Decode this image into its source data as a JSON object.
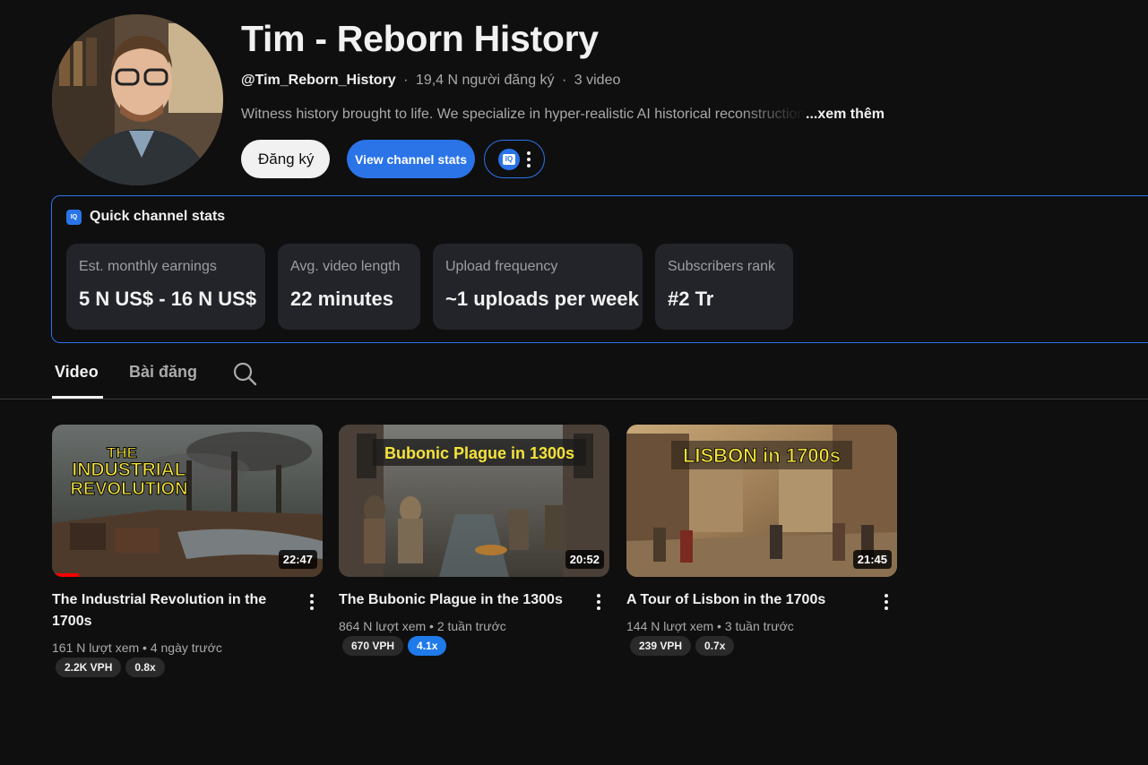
{
  "channel": {
    "name": "Tim - Reborn History",
    "handle": "@Tim_Reborn_History",
    "subscribers": "19,4 N người đăng ký",
    "videos_count": "3 video",
    "meta_separator": "·",
    "description": "Witness history brought to life. We specialize in hyper-realistic AI historical reconstructions",
    "more_label": "...xem thêm"
  },
  "actions": {
    "subscribe_label": "Đăng ký",
    "stats_label": "View channel stats"
  },
  "quick_stats": {
    "title": "Quick channel stats",
    "cards": [
      {
        "label": "Est. monthly earnings",
        "value": "5 N US$ - 16 N US$"
      },
      {
        "label": "Avg. video length",
        "value": "22 minutes"
      },
      {
        "label": "Upload frequency",
        "value": "~1 uploads per week"
      },
      {
        "label": "Subscribers rank",
        "value": "#2 Tr"
      }
    ]
  },
  "tabs": [
    {
      "label": "Video",
      "active": true
    },
    {
      "label": "Bài đăng",
      "active": false
    }
  ],
  "videos": [
    {
      "title": "The Industrial Revolution in the 1700s",
      "duration": "22:47",
      "views": "161 N lượt xem",
      "age": "4 ngày trước",
      "vph": "2.2K VPH",
      "ratio": "0.8x",
      "ratio_highlight": false,
      "thumb_text": [
        "THE",
        "INDUSTRIAL",
        "REVOLUTION"
      ],
      "watched_fraction": 0.1
    },
    {
      "title": "The Bubonic Plague in the 1300s",
      "duration": "20:52",
      "views": "864 N lượt xem",
      "age": "2 tuần trước",
      "vph": "670 VPH",
      "ratio": "4.1x",
      "ratio_highlight": true,
      "thumb_text": [
        "Bubonic Plague in 1300s"
      ]
    },
    {
      "title": "A Tour of Lisbon in the 1700s",
      "duration": "21:45",
      "views": "144 N lượt xem",
      "age": "3 tuần trước",
      "vph": "239 VPH",
      "ratio": "0.7x",
      "ratio_highlight": false,
      "thumb_text": [
        "LISBON in 1700s"
      ]
    }
  ],
  "colors": {
    "background": "#0f0f0f",
    "accent_blue": "#2a74e8",
    "card_bg": "#222429",
    "progress_red": "#ff0000",
    "thumb_title_yellow": "#f5e33a"
  },
  "icons": {
    "search": "search-icon",
    "menu": "more-vert-icon",
    "iq": "vidiq-icon"
  }
}
